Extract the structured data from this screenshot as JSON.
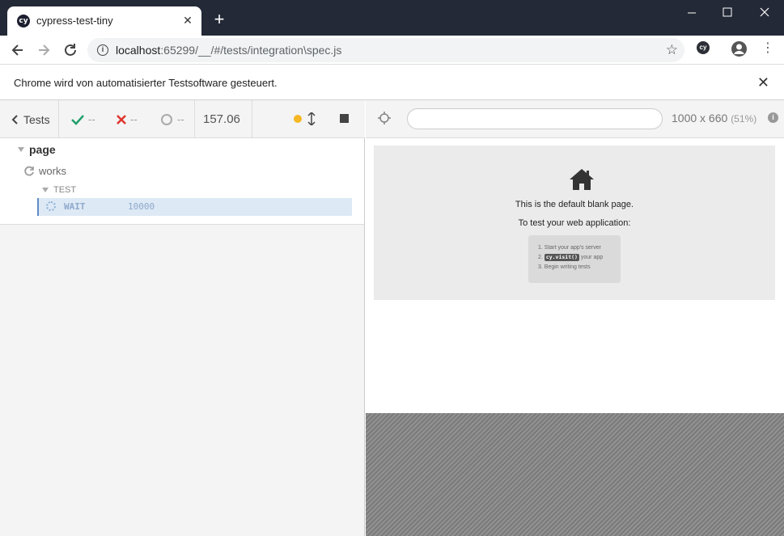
{
  "browser": {
    "tab_title": "cypress-test-tiny",
    "tab_favicon": "cy",
    "url_host": "localhost",
    "url_rest": ":65299/__/#/tests/integration\\spec.js",
    "extension_label": "cy",
    "infobar_text": "Chrome wird von automatisierter Testsoftware gesteuert."
  },
  "reporter": {
    "tests_label": "Tests",
    "passed": "--",
    "failed": "--",
    "pending": "--",
    "duration": "157.06",
    "status_color": "#f5b723",
    "suite_title": "page",
    "test_title": "works",
    "hooks_title": "TEST",
    "command_name": "WAIT",
    "command_message": "10000"
  },
  "aut": {
    "url_value": "",
    "viewport_size": "1000 x 660",
    "viewport_scale": "(51%)",
    "blank_line1": "This is the default blank page.",
    "blank_line2": "To test your web application:",
    "step1": "1. Start your app's server",
    "step2_prefix": "2.",
    "step2_code": "cy.visit()",
    "step2_suffix": "your app",
    "step3": "3. Begin writing tests"
  },
  "colors": {
    "titlebar": "#232936",
    "passed": "#22a06b",
    "failed": "#e0342c",
    "running": "#f5b723",
    "command_highlight": "#dde9f5"
  }
}
